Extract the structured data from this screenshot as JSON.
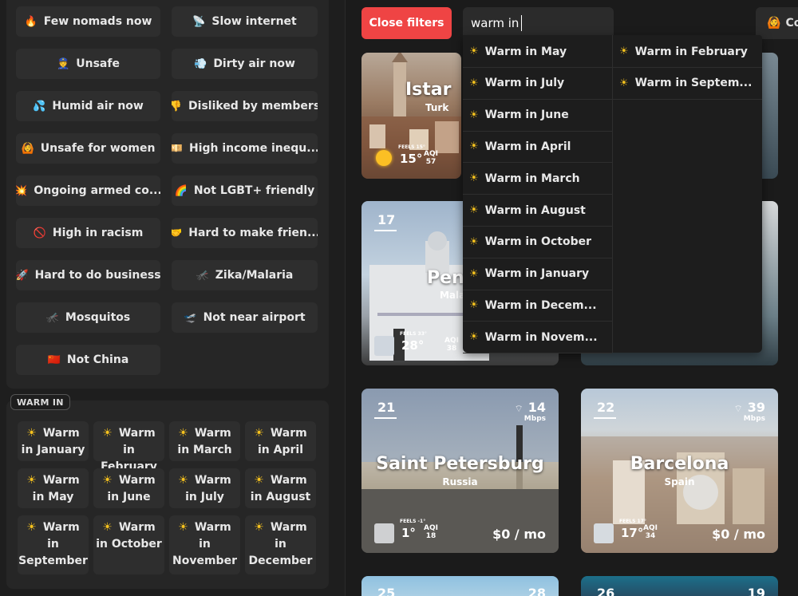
{
  "left_filters": [
    {
      "icon": "🔥",
      "label": "Few nomads now"
    },
    {
      "icon": "📡",
      "label": "Slow internet"
    },
    {
      "icon": "👮",
      "label": "Unsafe"
    },
    {
      "icon": "💨",
      "label": "Dirty air now"
    },
    {
      "icon": "💦",
      "label": "Humid air now"
    },
    {
      "icon": "👎",
      "label": "Disliked by members"
    },
    {
      "icon": "🙆",
      "label": "Unsafe for women"
    },
    {
      "icon": "💴",
      "label": "High income inequ..."
    },
    {
      "icon": "💥",
      "label": "Ongoing armed co..."
    },
    {
      "icon": "🌈",
      "label": "Not LGBT+ friendly"
    },
    {
      "icon": "🚫",
      "label": "High in racism"
    },
    {
      "icon": "🤝",
      "label": "Hard to make frien..."
    },
    {
      "icon": "🚀",
      "label": "Hard to do business"
    },
    {
      "icon": "🦟",
      "label": "Zika/Malaria"
    },
    {
      "icon": "🦟",
      "label": "Mosquitos"
    },
    {
      "icon": "🛫",
      "label": "Not near airport"
    },
    {
      "icon": "🇨🇳",
      "label": "Not China"
    }
  ],
  "warm_section": {
    "tag": "WARM IN",
    "items": [
      {
        "line1": "Warm",
        "line2": "in January"
      },
      {
        "line1": "Warm",
        "line2": "in February"
      },
      {
        "line1": "Warm",
        "line2": "in March"
      },
      {
        "line1": "Warm",
        "line2": "in April"
      },
      {
        "line1": "Warm",
        "line2": "in May"
      },
      {
        "line1": "Warm",
        "line2": "in June"
      },
      {
        "line1": "Warm",
        "line2": "in July"
      },
      {
        "line1": "Warm",
        "line2": "in August"
      },
      {
        "line1": "Warm",
        "line2": "in",
        "line3": "September"
      },
      {
        "line1": "Warm",
        "line2": "in October"
      },
      {
        "line1": "Warm",
        "line2": "in",
        "line3": "November"
      },
      {
        "line1": "Warm",
        "line2": "in",
        "line3": "December"
      }
    ]
  },
  "toolbar": {
    "close_filters": "Close filters",
    "search_value": "warm in",
    "corner_label": "Co"
  },
  "dropdown": {
    "col1": [
      "Warm in May",
      "Warm in July",
      "Warm in June",
      "Warm in April",
      "Warm in March",
      "Warm in August",
      "Warm in October",
      "Warm in January",
      "Warm in Decem...",
      "Warm in Novem..."
    ],
    "col2": [
      "Warm in February",
      "Warm in Septem..."
    ]
  },
  "cards": {
    "istanbul": {
      "city": "Istar",
      "country": "Turk",
      "feels": "FEELS 15°",
      "temp": "15°",
      "aqi_label": "AQI",
      "aqi": "57"
    },
    "penang": {
      "rank": "17",
      "city": "Pena",
      "country": "Mala",
      "feels": "FEELS 33°",
      "temp": "28°",
      "aqi_label": "AQI",
      "aqi": "38"
    },
    "spb": {
      "rank": "21",
      "city": "Saint Petersburg",
      "country": "Russia",
      "wifi": "14",
      "wifi_unit": "Mbps",
      "feels": "FEELS -1°",
      "temp": "1°",
      "aqi_label": "AQI",
      "aqi": "18",
      "price": "$0 / mo"
    },
    "barcelona": {
      "rank": "22",
      "city": "Barcelona",
      "country": "Spain",
      "wifi": "39",
      "wifi_unit": "Mbps",
      "feels": "FEELS 17°",
      "temp": "17°",
      "aqi_label": "AQI",
      "aqi": "34",
      "price": "$0 / mo"
    },
    "bottom_left": {
      "rank": "25",
      "wifi": "28"
    },
    "bottom_right": {
      "rank": "26",
      "wifi": "19"
    }
  },
  "colors": {
    "accent_red": "#ef4444",
    "sun": "#f6c21e",
    "bg": "#1b1b1b",
    "panel": "#262626",
    "button": "#2e2e2e"
  }
}
